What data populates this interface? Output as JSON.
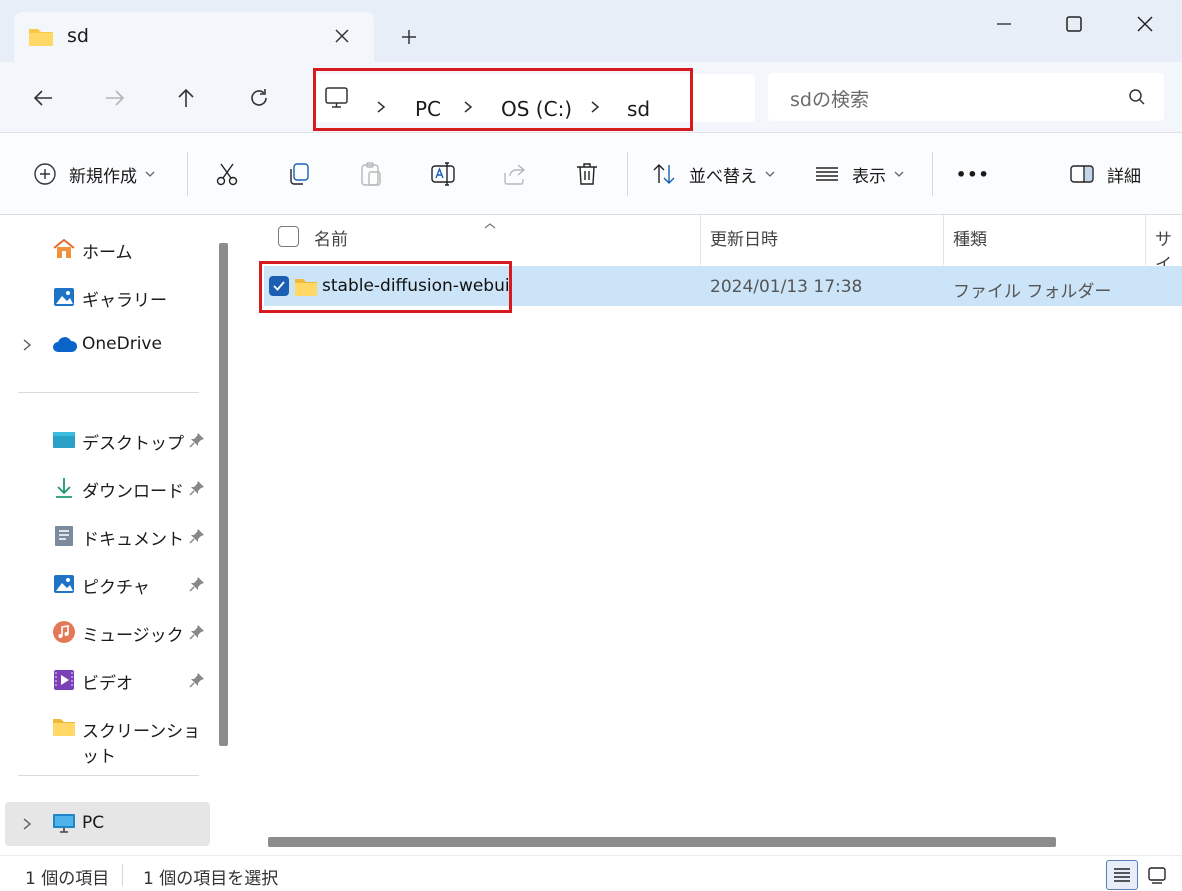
{
  "window": {
    "tab_title": "sd",
    "new_tab_symbol": "+"
  },
  "address": {
    "crumbs": [
      "PC",
      "OS (C:)",
      "sd"
    ]
  },
  "search": {
    "placeholder": "sdの検索"
  },
  "toolbar": {
    "new_label": "新規作成",
    "sort_label": "並べ替え",
    "view_label": "表示",
    "more_label": "•••",
    "details_label": "詳細"
  },
  "sidebar": {
    "items": [
      {
        "label": "ホーム",
        "icon": "home-icon"
      },
      {
        "label": "ギャラリー",
        "icon": "gallery-icon"
      },
      {
        "label": "OneDrive",
        "icon": "cloud-icon"
      },
      {
        "label": "デスクトップ",
        "icon": "desktop-icon"
      },
      {
        "label": "ダウンロード",
        "icon": "download-icon"
      },
      {
        "label": "ドキュメント",
        "icon": "document-icon"
      },
      {
        "label": "ピクチャ",
        "icon": "picture-icon"
      },
      {
        "label": "ミュージック",
        "icon": "music-icon"
      },
      {
        "label": "ビデオ",
        "icon": "video-icon"
      },
      {
        "label": "スクリーンショット",
        "icon": "folder-icon"
      },
      {
        "label": "PC",
        "icon": "pc-icon"
      }
    ]
  },
  "columns": {
    "name": "名前",
    "date": "更新日時",
    "type": "種類",
    "size": "サイ"
  },
  "files": [
    {
      "name": "stable-diffusion-webui",
      "date": "2024/01/13 17:38",
      "type": "ファイル フォルダー",
      "selected": true
    }
  ],
  "status": {
    "count": "1 個の項目",
    "selected": "1 個の項目を選択"
  },
  "colors": {
    "highlight": "#d71920",
    "selection": "#cce4f7",
    "accent": "#1b5fb2"
  }
}
